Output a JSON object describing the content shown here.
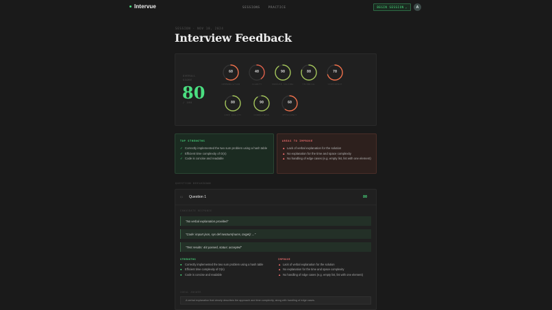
{
  "nav": {
    "brand": "Intervue",
    "links": [
      "SESSIONS",
      "PRACTICE"
    ],
    "begin_label": "BEGIN SESSION",
    "begin_caret": "⌄",
    "avatar_initial": "A"
  },
  "header": {
    "meta": "SESSION · NOV 18, 2024",
    "title": "Interview Feedback"
  },
  "scores": {
    "overall_label": "OVERALL SCORE",
    "overall_value": "80",
    "overall_sub": "/ 100",
    "gauges": [
      {
        "label": "COMMUNICATION",
        "value": 60,
        "color": "#f0704a"
      },
      {
        "label": "CLARITY",
        "value": 40,
        "color": "#e0604a"
      },
      {
        "label": "PROBLEM SOLVING",
        "value": 90,
        "color": "#a3c45a"
      },
      {
        "label": "TECHNICAL",
        "value": 80,
        "color": "#a3c45a"
      },
      {
        "label": "CONFIDENCE",
        "value": 70,
        "color": "#f0704a"
      },
      {
        "label": "CODE QUALITY",
        "value": 80,
        "color": "#a3c45a"
      },
      {
        "label": "CORRECTNESS",
        "value": 90,
        "color": "#a3c45a"
      },
      {
        "label": "EFFICIENCY",
        "value": 60,
        "color": "#f0704a"
      }
    ]
  },
  "strengths": {
    "title": "TOP STRENGTHS",
    "items": [
      "Correctly implemented the two sum problem using a hash table",
      "Efficient time complexity of O(n)",
      "Code is concise and readable"
    ]
  },
  "improve": {
    "title": "AREAS TO IMPROVE",
    "items": [
      "Lack of verbal explanation for the solution",
      "No explanation for the time and space complexity",
      "No handling of edge cases (e.g. empty list, list with one element)"
    ]
  },
  "breakdown": {
    "section_label": "QUESTION BREAKDOWN",
    "question": {
      "number": "Q1",
      "title": "Question 1",
      "score": "80",
      "response_label": "CANDIDATE RESPONSE",
      "quotes": [
        "\"No verbal explanation provided\"",
        "\"Code: import json, sys def twoSum(nums, target): ...\"",
        "\"Test results: 4/4 passed, status: accepted\""
      ],
      "strengths_title": "STRENGTHS",
      "strengths": [
        "Correctly implemented the two sum problem using a hash table",
        "Efficient time complexity of O(n)",
        "Code is concise and readable"
      ],
      "improve_title": "IMPROVE",
      "improve": [
        "Lack of verbal explanation for the solution",
        "No explanation for the time and space complexity",
        "No handling of edge cases (e.g. empty list, list with one element)"
      ],
      "ideal_label": "IDEAL ANSWER",
      "ideal": "A verbal explanation that clearly describes the approach and time complexity, along with handling of edge cases."
    }
  }
}
